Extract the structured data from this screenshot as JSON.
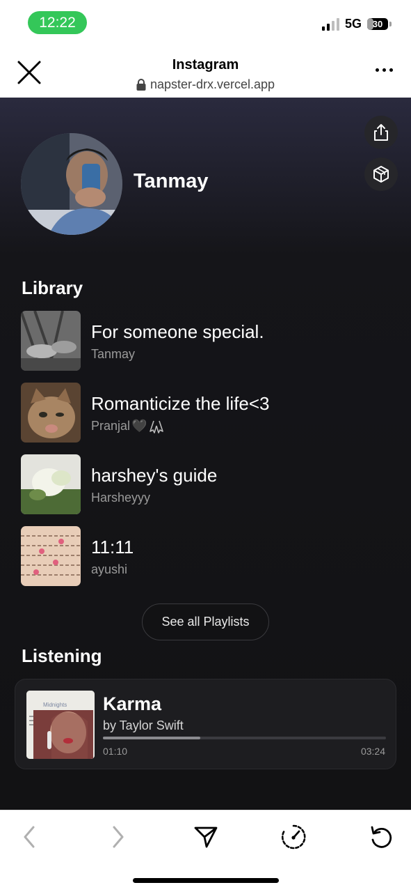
{
  "status_bar": {
    "time": "12:22",
    "network": "5G",
    "battery": "30",
    "battery_level_percent": 30,
    "time_pill_color": "#34c759"
  },
  "browser": {
    "title": "Instagram",
    "url": "napster-drx.vercel.app",
    "close_icon": "close-icon",
    "more_icon": "more-icon",
    "lock_icon": "lock-icon"
  },
  "profile": {
    "name": "Tanmay",
    "share_icon": "share-icon",
    "embed_icon": "cube-icon"
  },
  "library": {
    "title": "Library",
    "playlists": [
      {
        "title": "For someone special.",
        "author": "Tanmay"
      },
      {
        "title": "Romanticize the life<3",
        "author": "Pranjal",
        "author_emoji": "🖤"
      },
      {
        "title": "harshey's guide",
        "author": "Harsheyyy"
      },
      {
        "title": "11:11",
        "author": "ayushi"
      }
    ],
    "see_all_label": "See all Playlists"
  },
  "listening": {
    "title": "Listening",
    "track": {
      "title": "Karma",
      "artist": "by Taylor Swift",
      "album_label": "Midnights",
      "current_time": "01:10",
      "total_time": "03:24",
      "progress_percent": 34.3
    }
  },
  "toolbar": {
    "back_icon": "chevron-left-icon",
    "forward_icon": "chevron-right-icon",
    "share_icon": "send-icon",
    "speed_icon": "speedometer-icon",
    "reload_icon": "reload-icon"
  },
  "colors": {
    "accent_green": "#34c759",
    "background_dark": "#121214",
    "card": "#1d1d20"
  }
}
